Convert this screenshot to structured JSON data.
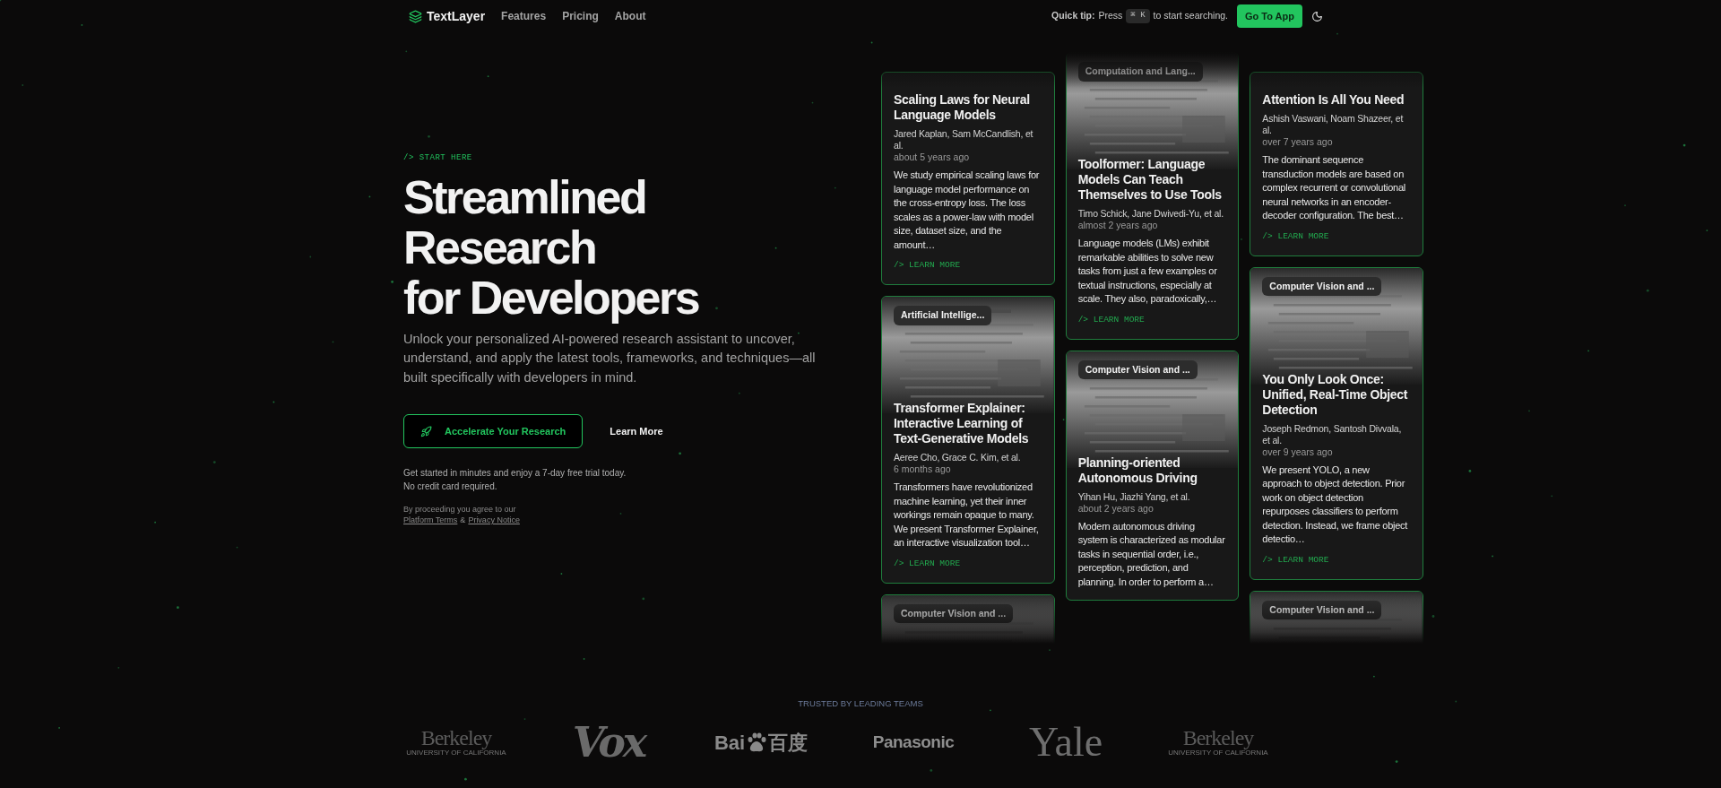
{
  "nav": {
    "brand": "TextLayer",
    "links": [
      "Features",
      "Pricing",
      "About"
    ],
    "quick_tip": {
      "label": "Quick tip:",
      "before": "Press",
      "keys": [
        "⌘",
        "K"
      ],
      "after": "to start searching."
    },
    "cta": "Go To App"
  },
  "hero": {
    "eyebrow": "/> START HERE",
    "title_lines": [
      "Streamlined",
      "Research",
      "for Developers"
    ],
    "subtitle": "Unlock your personalized AI-powered research assistant to uncover, understand, and apply the latest tools, frameworks, and techniques—all built specifically with developers in mind.",
    "primary_button": "Accelerate Your Research",
    "secondary_button": "Learn More",
    "trial_note_lines": [
      "Get started in minutes and enjoy a 7-day free trial today.",
      "No credit card required."
    ],
    "legal": {
      "text": "By proceeding you agree to our",
      "links": [
        "Platform Terms",
        "Privacy Notice"
      ],
      "separator": "&"
    }
  },
  "paper_columns": [
    [
      {
        "title": "Scaling Laws for Neural Language Models",
        "authors": "Jared Kaplan, Sam McCandlish, et al.",
        "age": "about 5 years ago",
        "abstract": "We study empirical scaling laws for language model performance on the cross-entropy loss. The loss scales as a power-law with model size, dataset size, and the amount…",
        "link": "/> LEARN MORE"
      },
      {
        "badge": "Artificial Intellige...",
        "title": "Transformer Explainer: Interactive Learning of Text-Generative Models",
        "authors": "Aeree Cho, Grace C. Kim, et al.",
        "age": "6 months ago",
        "abstract": "Transformers have revolutionized machine learning, yet their inner workings remain opaque to many. We present Transformer Explainer, an interactive visualization tool…",
        "link": "/> LEARN MORE"
      },
      {
        "badge": "Computer Vision and ..."
      }
    ],
    [
      {
        "badge": "Computation and Lang...",
        "title": "Toolformer: Language Models Can Teach Themselves to Use Tools",
        "authors": "Timo Schick, Jane Dwivedi-Yu, et al.",
        "age": "almost 2 years ago",
        "abstract": "Language models (LMs) exhibit remarkable abilities to solve new tasks from just a few examples or textual instructions, especially at scale. They also, paradoxically,…",
        "link": "/> LEARN MORE"
      },
      {
        "badge": "Computer Vision and ...",
        "title": "Planning-oriented Autonomous Driving",
        "authors": "Yihan Hu, Jiazhi Yang, et al.",
        "age": "about 2 years ago",
        "abstract": "Modern autonomous driving system is characterized as modular tasks in sequential order, i.e., perception, prediction, and planning. In order to perform a…"
      }
    ],
    [
      {
        "title": "Attention Is All You Need",
        "authors": "Ashish Vaswani, Noam Shazeer, et al.",
        "age": "over 7 years ago",
        "abstract": "The dominant sequence transduction models are based on complex recurrent or convolutional neural networks in an encoder-decoder configuration. The best…",
        "link": "/> LEARN MORE"
      },
      {
        "badge": "Computer Vision and ...",
        "title": "You Only Look Once: Unified, Real-Time Object Detection",
        "authors": "Joseph Redmon, Santosh Divvala, et al.",
        "age": "over 9 years ago",
        "abstract": "We present YOLO, a new approach to object detection. Prior work on object detection repurposes classifiers to perform detection. Instead, we frame object detectio…",
        "link": "/> LEARN MORE"
      },
      {
        "badge": "Computer Vision and ..."
      }
    ]
  ],
  "trusted": {
    "heading": "TRUSTED BY LEADING TEAMS",
    "logos": [
      {
        "kind": "seal",
        "text": "Berkeley",
        "subtext": "UNIVERSITY OF CALIFORNIA"
      },
      {
        "kind": "slab",
        "text": "Vox"
      },
      {
        "kind": "paw",
        "text": "Bai",
        "text_after": "百度"
      },
      {
        "kind": "sans",
        "text": "Panasonic"
      },
      {
        "kind": "serif",
        "text": "Yale"
      },
      {
        "kind": "seal",
        "text": "Berkeley",
        "subtext": "UNIVERSITY OF CALIFORNIA"
      }
    ]
  }
}
